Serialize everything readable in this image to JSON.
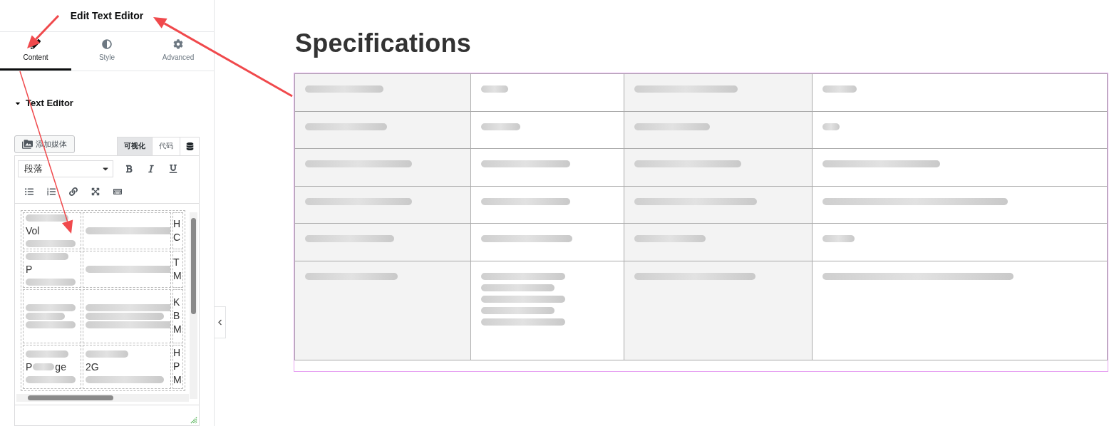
{
  "panel": {
    "title": "Edit Text Editor",
    "tabs": [
      {
        "label": "Content",
        "selected": true
      },
      {
        "label": "Style",
        "selected": false
      },
      {
        "label": "Advanced",
        "selected": false
      }
    ],
    "section": {
      "title": "Text Editor",
      "expanded": true
    },
    "editor": {
      "media_button": "添加媒体",
      "modes": [
        {
          "label": "可视化",
          "selected": true
        },
        {
          "label": "代码",
          "selected": false
        }
      ],
      "format_select": "段落",
      "rows": [
        {
          "cells": [
            {
              "parts": [
                "Vol"
              ]
            },
            {
              "kind": "redacted"
            },
            {
              "parts": [
                "H",
                "C"
              ]
            }
          ]
        },
        {
          "cells": [
            {
              "parts": [
                "P"
              ]
            },
            {
              "kind": "redacted"
            },
            {
              "parts": [
                "T",
                "M"
              ]
            }
          ]
        },
        {
          "cells": [
            {
              "kind": "redacted"
            },
            {
              "kind": "redacted"
            },
            {
              "parts": [
                "K",
                "B",
                "M"
              ]
            }
          ]
        },
        {
          "cells": [
            {
              "parts": [
                "P",
                "ge"
              ]
            },
            {
              "parts": [
                "2G"
              ]
            },
            {
              "parts": [
                "H",
                "P",
                "M"
              ]
            }
          ]
        }
      ]
    }
  },
  "page": {
    "heading": "Specifications",
    "table": {
      "rows": [
        {
          "cells": [
            {
              "kind": "redacted"
            },
            {
              "kind": "redacted"
            },
            {
              "kind": "redacted"
            },
            {
              "kind": "redacted"
            }
          ]
        },
        {
          "cells": [
            {
              "kind": "redacted"
            },
            {
              "kind": "redacted"
            },
            {
              "kind": "redacted"
            },
            {
              "kind": "redacted"
            }
          ]
        },
        {
          "cells": [
            {
              "kind": "redacted"
            },
            {
              "kind": "redacted"
            },
            {
              "kind": "redacted"
            },
            {
              "kind": "redacted"
            }
          ]
        },
        {
          "cells": [
            {
              "kind": "redacted"
            },
            {
              "kind": "redacted"
            },
            {
              "kind": "redacted"
            },
            {
              "kind": "redacted"
            }
          ]
        },
        {
          "cells": [
            {
              "kind": "redacted"
            },
            {
              "kind": "redacted"
            },
            {
              "kind": "redacted"
            },
            {
              "kind": "redacted"
            }
          ]
        },
        {
          "cells": [
            {
              "kind": "redacted"
            },
            {
              "kind": "redacted"
            },
            {
              "kind": "redacted"
            },
            {
              "kind": "redacted"
            }
          ]
        }
      ]
    }
  },
  "annotations": [
    {
      "kind": "arrow"
    },
    {
      "kind": "arrow"
    },
    {
      "kind": "arrow"
    }
  ]
}
